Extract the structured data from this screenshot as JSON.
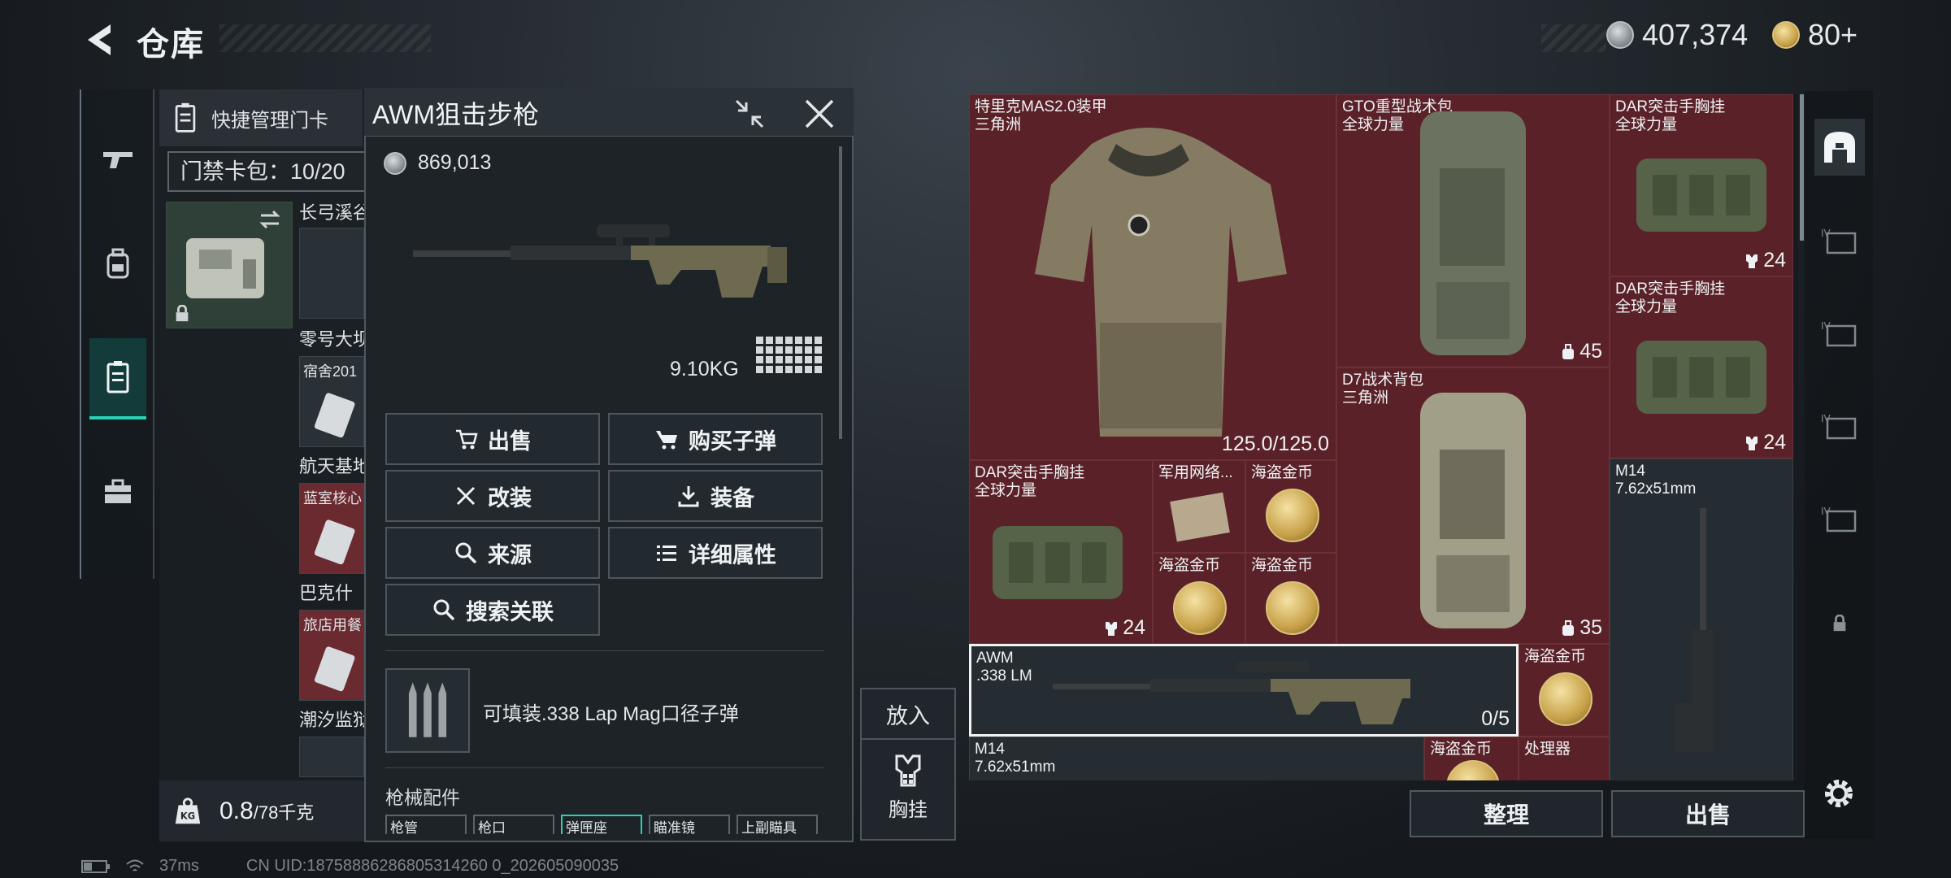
{
  "header": {
    "title": "仓库",
    "silver": "407,374",
    "gold": "80+"
  },
  "left_panel": {
    "quick_manage_label": "快捷管理门卡",
    "gate_bag_label": "门禁卡包：10/20",
    "items": [
      {
        "label": "长弓溪谷"
      },
      {
        "label": "零号大坝"
      },
      {
        "label": "宿舍201"
      },
      {
        "label": "航天基地"
      },
      {
        "label": "蓝室核心"
      },
      {
        "label": "巴克什"
      },
      {
        "label": "旅店用餐"
      },
      {
        "label": "潮汐监狱"
      }
    ],
    "weight_value": "0.8",
    "weight_unit": "/78千克"
  },
  "detail": {
    "title": "AWM狙击步枪",
    "price": "869,013",
    "weight": "9.10KG",
    "actions": {
      "sell": "出售",
      "buy_ammo": "购买子弹",
      "modify": "改装",
      "equip": "装备",
      "source": "来源",
      "details": "详细属性",
      "search": "搜索关联"
    },
    "ammo_text": "可填装.338 Lap Mag口径子弹",
    "attachments_title": "枪械配件",
    "attachment_tabs": [
      "枪管",
      "枪口",
      "弹匣座",
      "瞄准镜",
      "上副瞄具"
    ]
  },
  "put_in": {
    "label": "放入",
    "vest_label": "胸挂"
  },
  "grid_items": {
    "armor": {
      "line1": "特里克MAS2.0装甲",
      "line2": "三角洲",
      "count": "125.0/125.0"
    },
    "gto_bag": {
      "line1": "GTO重型战术包",
      "line2": "全球力量",
      "count": "45"
    },
    "dar_1": {
      "line1": "DAR突击手胸挂",
      "line2": "全球力量",
      "count": "24"
    },
    "dar_2": {
      "line1": "DAR突击手胸挂",
      "line2": "全球力量",
      "count": "24"
    },
    "d7_bag": {
      "line1": "D7战术背包",
      "line2": "三角洲",
      "count": "35"
    },
    "dar_3": {
      "line1": "DAR突击手胸挂",
      "line2": "全球力量",
      "count": "24"
    },
    "network": {
      "line1": "军用网络..."
    },
    "coin_1": {
      "line1": "海盗金币"
    },
    "coin_2": {
      "line1": "海盗金币"
    },
    "coin_3": {
      "line1": "海盗金币"
    },
    "m14_1": {
      "line1": "M14",
      "line2": "7.62x51mm"
    },
    "awm": {
      "line1": "AWM",
      "line2": ".338 LM",
      "count": "0/5"
    },
    "coin_4": {
      "line1": "海盗金币"
    },
    "m14_2": {
      "line1": "M14",
      "line2": "7.62x51mm"
    },
    "coin_5": {
      "line1": "海盗金币"
    },
    "processor": {
      "line1": "处理器"
    }
  },
  "bottom_buttons": {
    "organize": "整理",
    "sell": "出售"
  },
  "status_bar": {
    "ping": "37ms",
    "uid": "CN UID:18758886286805314260 0_202605090035"
  },
  "colors": {
    "accent": "#2bd1b7",
    "red_cell": "#5a2228"
  }
}
